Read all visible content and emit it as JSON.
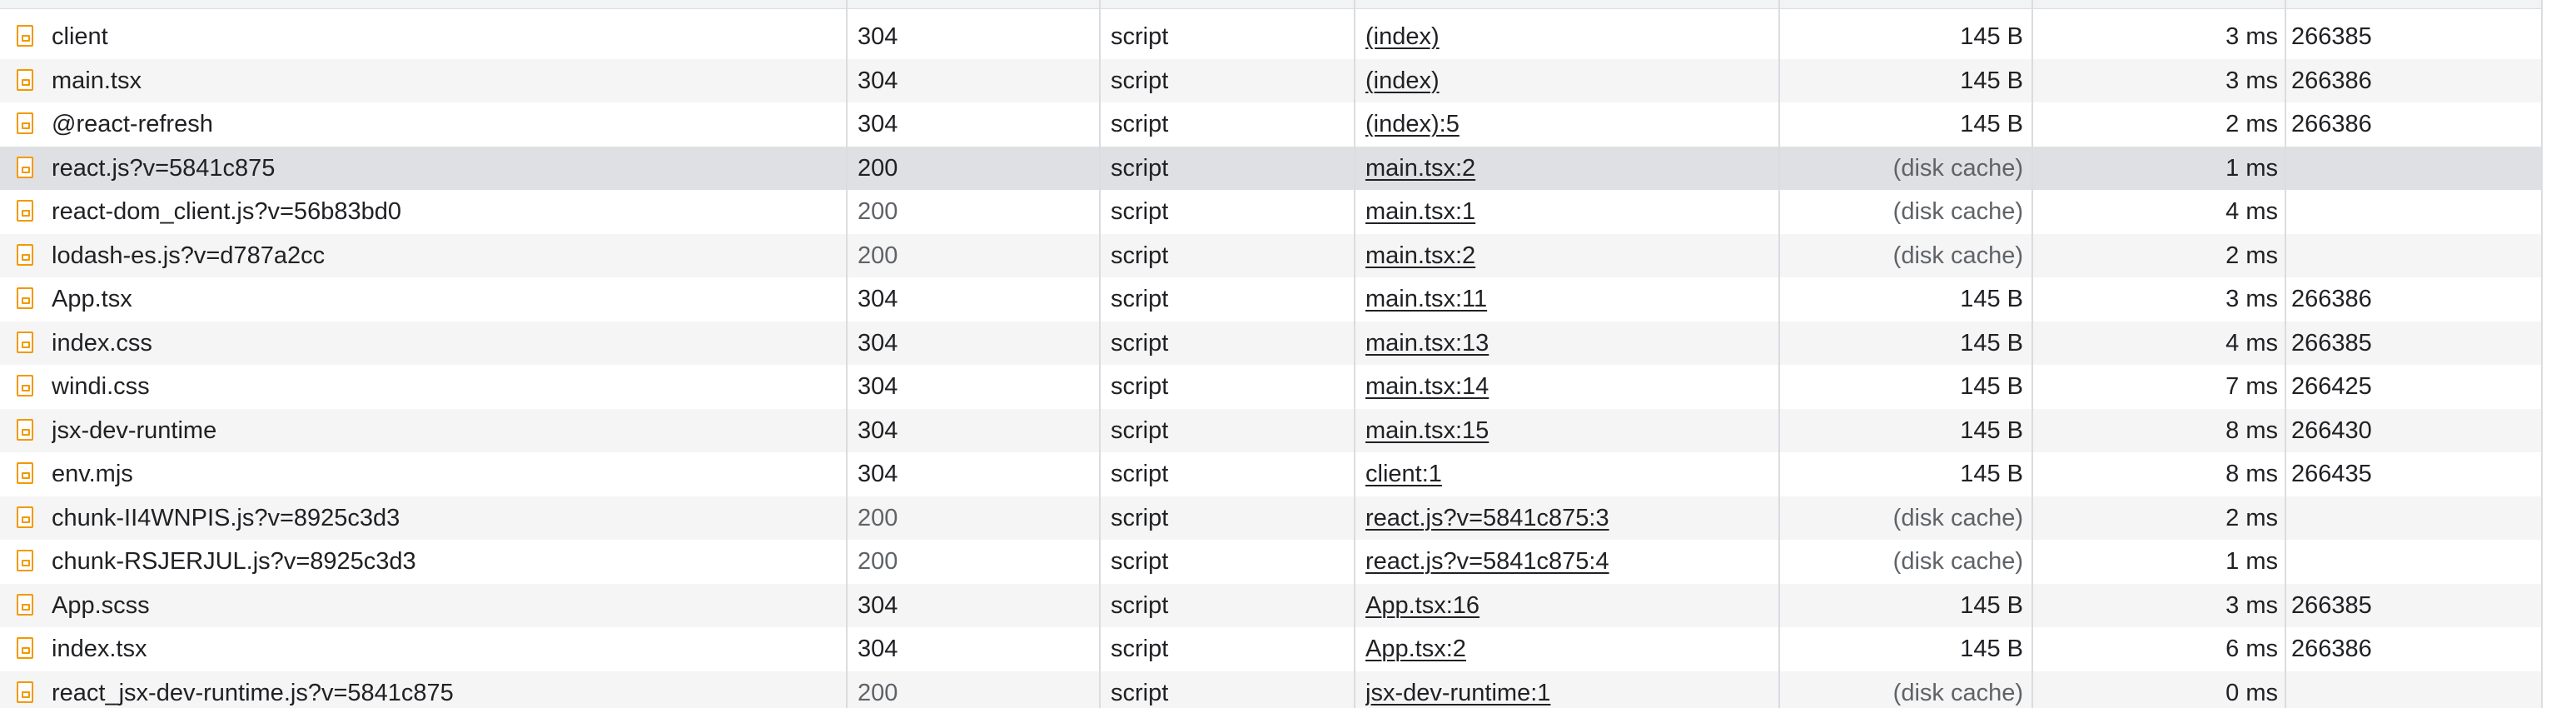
{
  "requests": [
    {
      "name": "client",
      "status": "304",
      "type": "script",
      "initiator": "(index)",
      "size": "145 B",
      "time": "3 ms",
      "extra": "266385"
    },
    {
      "name": "main.tsx",
      "status": "304",
      "type": "script",
      "initiator": "(index)",
      "size": "145 B",
      "time": "3 ms",
      "extra": "266386"
    },
    {
      "name": "@react-refresh",
      "status": "304",
      "type": "script",
      "initiator": "(index):5",
      "size": "145 B",
      "time": "2 ms",
      "extra": "266386"
    },
    {
      "name": "react.js?v=5841c875",
      "status": "200",
      "type": "script",
      "initiator": "main.tsx:2",
      "size": "(disk cache)",
      "time": "1 ms",
      "extra": "",
      "selected": true
    },
    {
      "name": "react-dom_client.js?v=56b83bd0",
      "status": "200",
      "type": "script",
      "initiator": "main.tsx:1",
      "size": "(disk cache)",
      "time": "4 ms",
      "extra": ""
    },
    {
      "name": "lodash-es.js?v=d787a2cc",
      "status": "200",
      "type": "script",
      "initiator": "main.tsx:2",
      "size": "(disk cache)",
      "time": "2 ms",
      "extra": ""
    },
    {
      "name": "App.tsx",
      "status": "304",
      "type": "script",
      "initiator": "main.tsx:11",
      "size": "145 B",
      "time": "3 ms",
      "extra": "266386"
    },
    {
      "name": "index.css",
      "status": "304",
      "type": "script",
      "initiator": "main.tsx:13",
      "size": "145 B",
      "time": "4 ms",
      "extra": "266385"
    },
    {
      "name": "windi.css",
      "status": "304",
      "type": "script",
      "initiator": "main.tsx:14",
      "size": "145 B",
      "time": "7 ms",
      "extra": "266425"
    },
    {
      "name": "jsx-dev-runtime",
      "status": "304",
      "type": "script",
      "initiator": "main.tsx:15",
      "size": "145 B",
      "time": "8 ms",
      "extra": "266430"
    },
    {
      "name": "env.mjs",
      "status": "304",
      "type": "script",
      "initiator": "client:1",
      "size": "145 B",
      "time": "8 ms",
      "extra": "266435"
    },
    {
      "name": "chunk-II4WNPIS.js?v=8925c3d3",
      "status": "200",
      "type": "script",
      "initiator": "react.js?v=5841c875:3",
      "size": "(disk cache)",
      "time": "2 ms",
      "extra": ""
    },
    {
      "name": "chunk-RSJERJUL.js?v=8925c3d3",
      "status": "200",
      "type": "script",
      "initiator": "react.js?v=5841c875:4",
      "size": "(disk cache)",
      "time": "1 ms",
      "extra": ""
    },
    {
      "name": "App.scss",
      "status": "304",
      "type": "script",
      "initiator": "App.tsx:16",
      "size": "145 B",
      "time": "3 ms",
      "extra": "266385"
    },
    {
      "name": "index.tsx",
      "status": "304",
      "type": "script",
      "initiator": "App.tsx:2",
      "size": "145 B",
      "time": "6 ms",
      "extra": "266386"
    },
    {
      "name": "react_jsx-dev-runtime.js?v=5841c875",
      "status": "200",
      "type": "script",
      "initiator": "jsx-dev-runtime:1",
      "size": "(disk cache)",
      "time": "0 ms",
      "extra": ""
    }
  ],
  "icons": {
    "file": "script-file-icon"
  },
  "colors": {
    "icon_orange": "#f29900",
    "row_alt": "#f5f5f5",
    "row_selected": "#dfe0e3"
  }
}
